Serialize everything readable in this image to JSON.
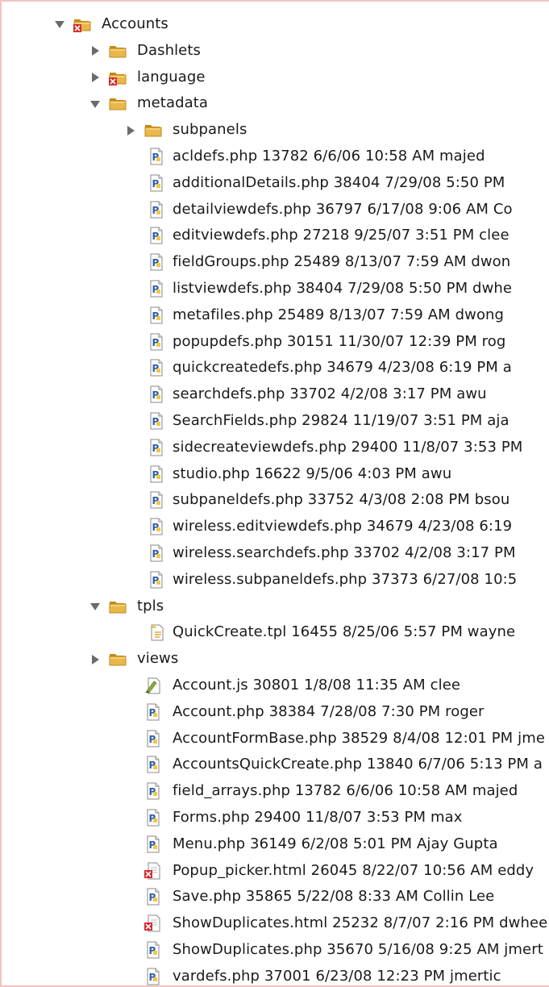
{
  "tree": [
    {
      "label": "Accounts",
      "icon": "folder-error-icon",
      "twisty": "expanded",
      "depth": 0
    },
    {
      "label": "Dashlets",
      "icon": "folder-icon",
      "twisty": "collapsed",
      "depth": 1
    },
    {
      "label": "language",
      "icon": "folder-error-icon",
      "twisty": "collapsed",
      "depth": 1
    },
    {
      "label": "metadata",
      "icon": "folder-icon",
      "twisty": "expanded",
      "depth": 1
    },
    {
      "label": "subpanels",
      "icon": "folder-icon",
      "twisty": "collapsed",
      "depth": 2
    },
    {
      "label": "acldefs.php 13782  6/6/06 10:58 AM  majed",
      "icon": "php-file-icon",
      "twisty": "none",
      "depth": 3
    },
    {
      "label": "additionalDetails.php 38404  7/29/08 5:50 PM",
      "icon": "php-file-icon",
      "twisty": "none",
      "depth": 3
    },
    {
      "label": "detailviewdefs.php 36797  6/17/08 9:06 AM  Co",
      "icon": "php-file-icon",
      "twisty": "none",
      "depth": 3
    },
    {
      "label": "editviewdefs.php 27218  9/25/07 3:51 PM  clee",
      "icon": "php-file-icon",
      "twisty": "none",
      "depth": 3
    },
    {
      "label": "fieldGroups.php 25489  8/13/07 7:59 AM  dwon",
      "icon": "php-file-icon",
      "twisty": "none",
      "depth": 3
    },
    {
      "label": "listviewdefs.php 38404  7/29/08 5:50 PM  dwhe",
      "icon": "php-file-icon",
      "twisty": "none",
      "depth": 3
    },
    {
      "label": "metafiles.php 25489  8/13/07 7:59 AM  dwong",
      "icon": "php-file-icon",
      "twisty": "none",
      "depth": 3
    },
    {
      "label": "popupdefs.php 30151  11/30/07 12:39 PM  rog",
      "icon": "php-file-icon",
      "twisty": "none",
      "depth": 3
    },
    {
      "label": "quickcreatedefs.php 34679  4/23/08 6:19 PM  a",
      "icon": "php-file-icon",
      "twisty": "none",
      "depth": 3
    },
    {
      "label": "searchdefs.php 33702  4/2/08 3:17 PM  awu",
      "icon": "php-file-icon",
      "twisty": "none",
      "depth": 3
    },
    {
      "label": "SearchFields.php 29824  11/19/07 3:51 PM  aja",
      "icon": "php-file-icon",
      "twisty": "none",
      "depth": 3
    },
    {
      "label": "sidecreateviewdefs.php 29400  11/8/07 3:53 PM",
      "icon": "php-file-icon",
      "twisty": "none",
      "depth": 3
    },
    {
      "label": "studio.php 16622  9/5/06 4:03 PM  awu",
      "icon": "php-file-icon",
      "twisty": "none",
      "depth": 3
    },
    {
      "label": "subpaneldefs.php 33752  4/3/08 2:08 PM  bsou",
      "icon": "php-file-icon",
      "twisty": "none",
      "depth": 3
    },
    {
      "label": "wireless.editviewdefs.php 34679  4/23/08 6:19",
      "icon": "php-file-icon",
      "twisty": "none",
      "depth": 3
    },
    {
      "label": "wireless.searchdefs.php 33702  4/2/08 3:17 PM",
      "icon": "php-file-icon",
      "twisty": "none",
      "depth": 3
    },
    {
      "label": "wireless.subpaneldefs.php 37373  6/27/08 10:5",
      "icon": "php-file-icon",
      "twisty": "none",
      "depth": 3
    },
    {
      "label": "tpls",
      "icon": "folder-icon",
      "twisty": "expanded",
      "depth": 1
    },
    {
      "label": "QuickCreate.tpl 16455  8/25/06 5:57 PM  wayne",
      "icon": "tpl-file-icon",
      "twisty": "none",
      "depth": 3
    },
    {
      "label": "views",
      "icon": "folder-icon",
      "twisty": "collapsed",
      "depth": 1
    },
    {
      "label": "Account.js 30801  1/8/08 11:35 AM  clee",
      "icon": "js-file-icon",
      "twisty": "none",
      "depth": 2
    },
    {
      "label": "Account.php 38384  7/28/08 7:30 PM  roger",
      "icon": "php-file-icon",
      "twisty": "none",
      "depth": 2
    },
    {
      "label": "AccountFormBase.php 38529  8/4/08 12:01 PM  jme",
      "icon": "php-file-icon",
      "twisty": "none",
      "depth": 2
    },
    {
      "label": "AccountsQuickCreate.php 13840  6/7/06 5:13 PM  a",
      "icon": "php-file-icon",
      "twisty": "none",
      "depth": 2
    },
    {
      "label": "field_arrays.php 13782  6/6/06 10:58 AM  majed",
      "icon": "php-file-icon",
      "twisty": "none",
      "depth": 2
    },
    {
      "label": "Forms.php 29400  11/8/07 3:53 PM  max",
      "icon": "php-file-icon",
      "twisty": "none",
      "depth": 2
    },
    {
      "label": "Menu.php 36149  6/2/08 5:01 PM  Ajay Gupta",
      "icon": "php-file-icon",
      "twisty": "none",
      "depth": 2
    },
    {
      "label": "Popup_picker.html 26045  8/22/07 10:56 AM  eddy",
      "icon": "html-file-error-icon",
      "twisty": "none",
      "depth": 2
    },
    {
      "label": "Save.php 35865  5/22/08 8:33 AM  Collin Lee",
      "icon": "php-file-icon",
      "twisty": "none",
      "depth": 2
    },
    {
      "label": "ShowDuplicates.html 25232  8/7/07 2:16 PM  dwhee",
      "icon": "html-file-error-icon",
      "twisty": "none",
      "depth": 2
    },
    {
      "label": "ShowDuplicates.php 35670  5/16/08 9:25 AM  jmert",
      "icon": "php-file-icon",
      "twisty": "none",
      "depth": 2
    },
    {
      "label": "vardefs.php 37001  6/23/08 12:23 PM  jmertic",
      "icon": "php-file-icon",
      "twisty": "none",
      "depth": 2
    }
  ],
  "colors": {
    "folder": "#e8b84a",
    "folder_dark": "#c08a1c",
    "error": "#d42a2a",
    "php_blue": "#2f5fa8",
    "twisty": "#6b6b6b",
    "frame_border": "#f2c4c4"
  }
}
